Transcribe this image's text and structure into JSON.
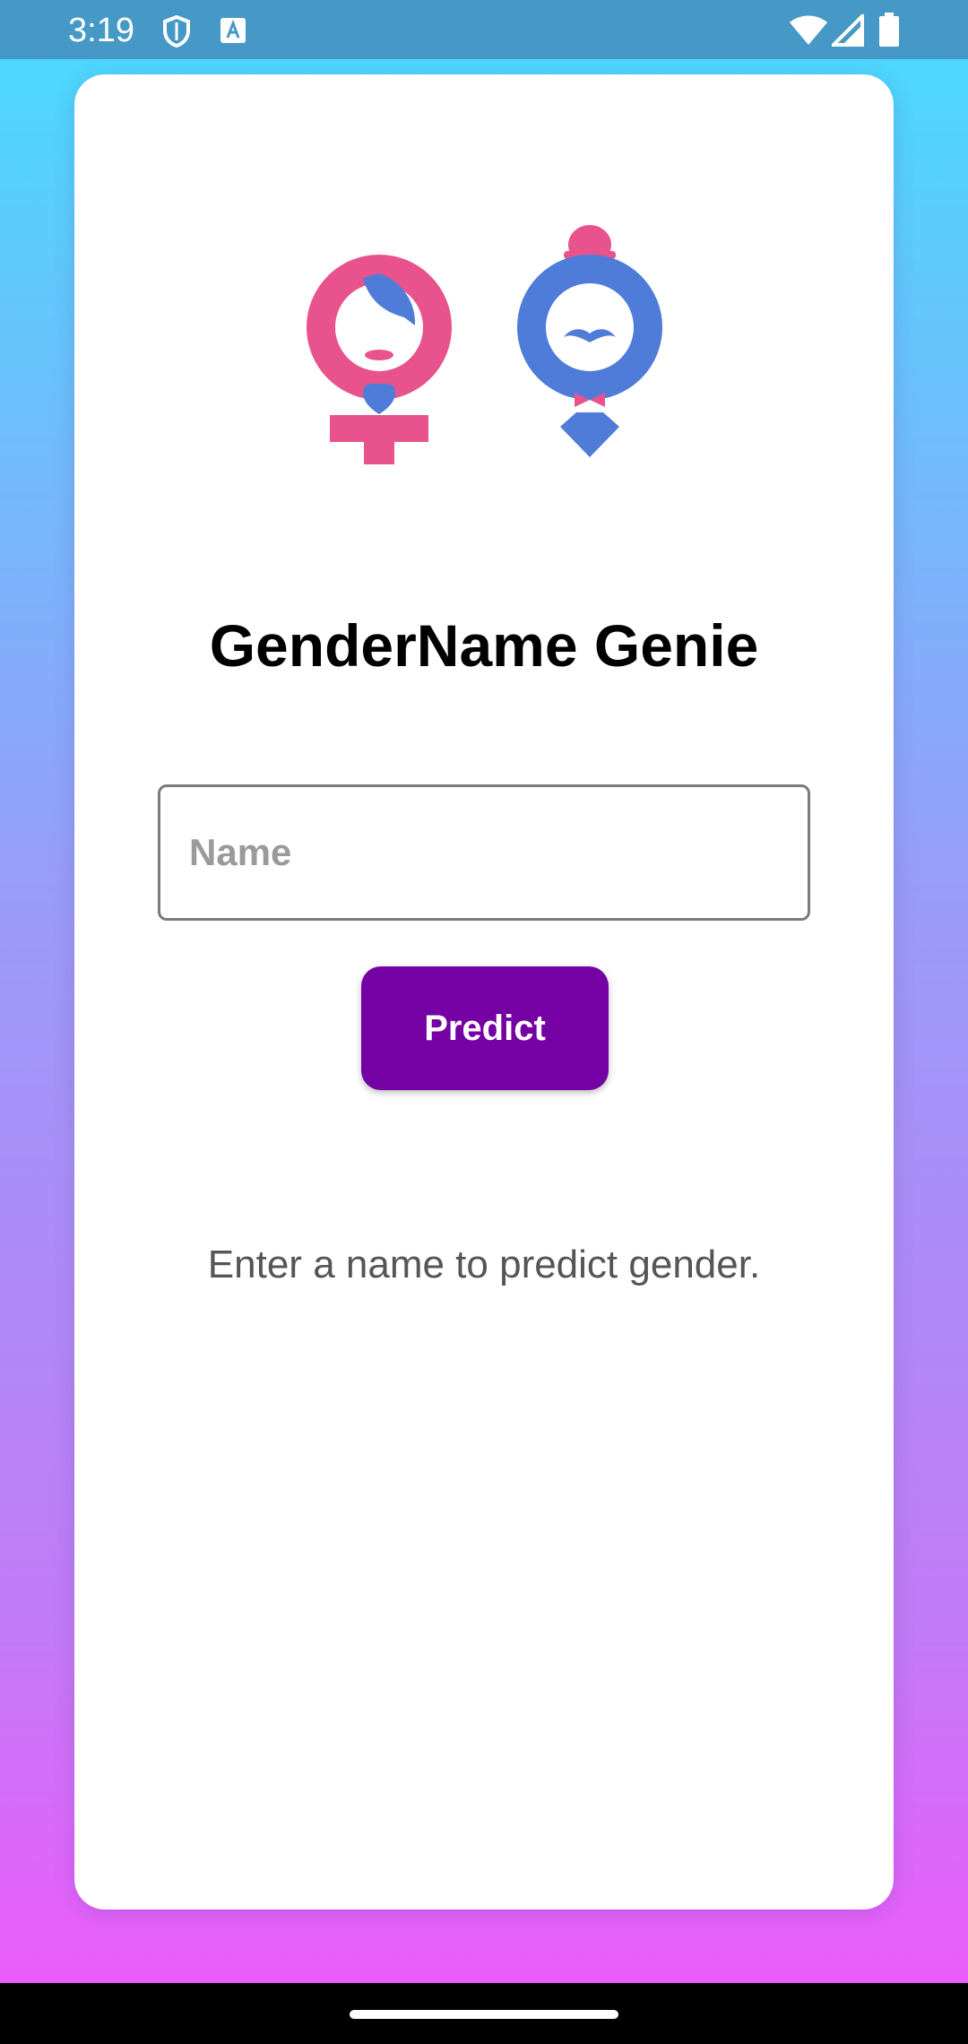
{
  "status_bar": {
    "time": "3:19",
    "left_icons": [
      "shield-icon",
      "font-a-icon"
    ],
    "right_icons": [
      "wifi-icon",
      "signal-icon",
      "battery-icon"
    ]
  },
  "logo": {
    "icons": [
      "female-symbol-icon",
      "male-symbol-icon"
    ],
    "colors": {
      "pink": "#e8538e",
      "blue": "#4f7cd9"
    }
  },
  "app_title": "GenderName Genie",
  "name_input": {
    "placeholder": "Name",
    "value": ""
  },
  "predict_button_label": "Predict",
  "hint": "Enter a name to predict gender.",
  "colors": {
    "accent": "#7500a3",
    "status_bar": "#4699c6",
    "gradient_top": "#47dcff",
    "gradient_bottom": "#f357fc"
  }
}
